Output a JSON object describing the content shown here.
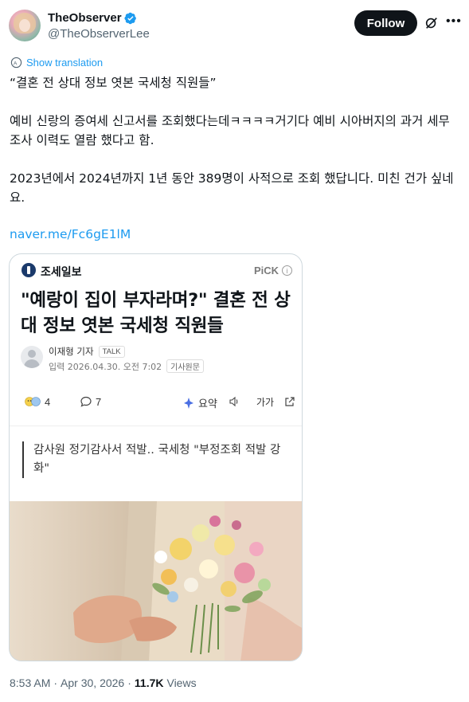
{
  "author": {
    "display_name": "TheObserver",
    "handle": "@TheObserverLee",
    "verified": true
  },
  "follow_label": "Follow",
  "icons": {
    "verified": "verified-badge-icon",
    "grok": "grok-icon",
    "more": "more-icon",
    "translate": "globe-icon"
  },
  "show_translation": "Show translation",
  "post": {
    "title_line": "“결혼 전 상대 정보 엿본 국세청 직원들”",
    "para1": "예비 신랑의 증여세 신고서를 조회했다는데ㅋㅋㅋㅋ거기다 예비 시아버지의 과거 세무조사 이력도 열람 했다고 함.",
    "para2": "2023년에서 2024년까지 1년 동안 389명이 사적으로 조회 했답니다. 미친 건가 싶네요.",
    "link": "naver.me/Fc6gE1lM"
  },
  "card": {
    "source": "조세일보",
    "pick": "PiCK",
    "headline": "\"예랑이 집이 부자라며?\" 결혼 전 상대 정보 엿본 국세청 직원들",
    "reporter": "이재형 기자",
    "talk": "TALK",
    "date_label": "입력 2026.04.30. 오전 7:02",
    "original_label": "기사원문",
    "reactions_count": "4",
    "comments_count": "7",
    "summary_label": "요약",
    "font_size_label": "가가",
    "quote": "감사원 정기감사서 적발.. 국세청 \"부정조회 적발 강화\""
  },
  "meta": {
    "time": "8:53 AM",
    "sep": "·",
    "date": "Apr 30, 2026",
    "views_count": "11.7K",
    "views_label": "Views"
  },
  "colors": {
    "accent": "#1d9bf0",
    "text": "#0f1419",
    "muted": "#536471",
    "follow_bg": "#0f1419"
  }
}
